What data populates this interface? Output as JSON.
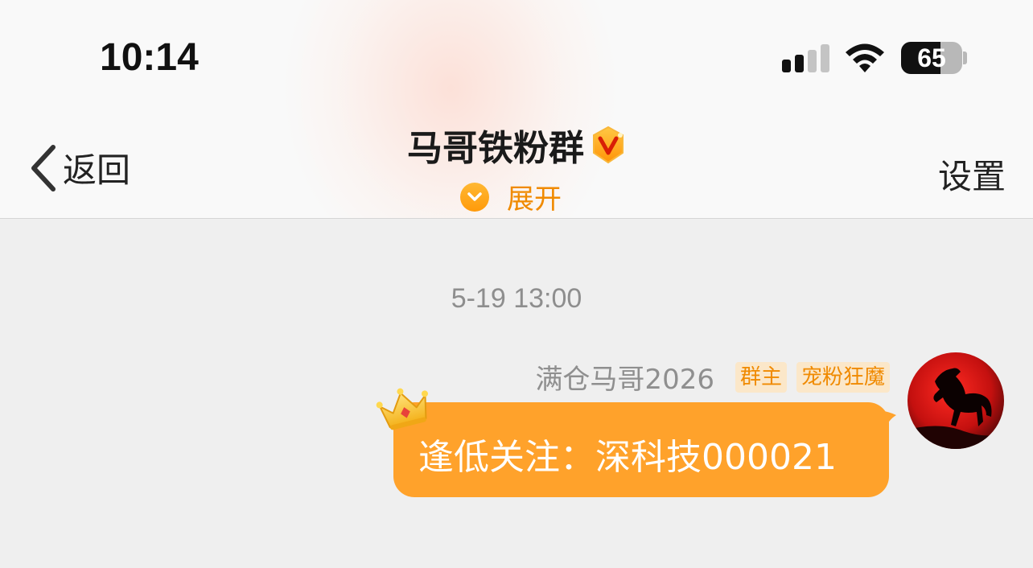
{
  "status_bar": {
    "time": "10:14",
    "battery": "65",
    "battery_level_percent": 65,
    "signal_bars_active": 2,
    "signal_bars_total": 4
  },
  "nav": {
    "back_label": "返回",
    "title": "马哥铁粉群",
    "expand_label": "展开",
    "settings_label": "设置"
  },
  "chat": {
    "timestamp": "5-19 13:00",
    "message": {
      "sender": "满仓马哥2026",
      "tags": [
        "群主",
        "宠粉狂魔"
      ],
      "text": "逢低关注：深科技000021"
    }
  },
  "icons": {
    "back": "chevron-left-icon",
    "verified": "verified-v-badge-icon",
    "expand": "chevron-down-icon",
    "wifi": "wifi-icon",
    "signal": "cellular-signal-icon",
    "battery": "battery-icon",
    "crown": "crown-icon",
    "avatar": "horse-avatar"
  },
  "colors": {
    "accent_orange": "#ffa22b",
    "tag_text": "#f08a00",
    "tag_background": "#fbe7c9",
    "chat_background": "#efefef",
    "avatar_red": "#d2151a"
  }
}
